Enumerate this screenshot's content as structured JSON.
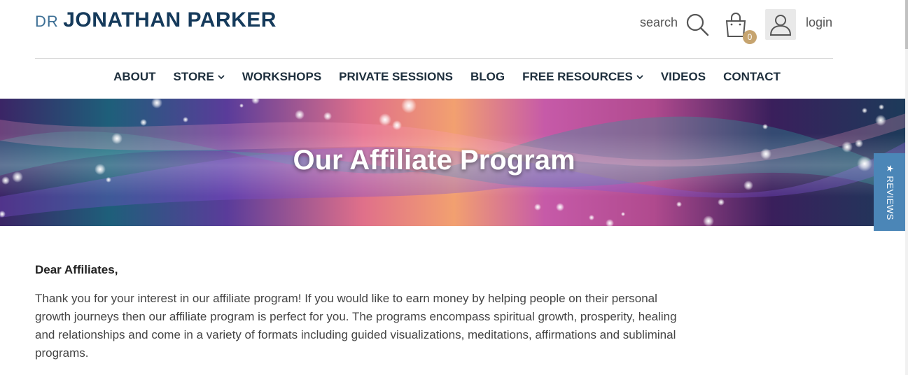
{
  "header": {
    "logo_prefix": "DR",
    "logo_name": "JONATHAN PARKER",
    "search_label": "search",
    "cart_count": "0",
    "login_label": "login",
    "nav": [
      {
        "label": "ABOUT",
        "dropdown": false
      },
      {
        "label": "STORE",
        "dropdown": true
      },
      {
        "label": "WORKSHOPS",
        "dropdown": false
      },
      {
        "label": "PRIVATE SESSIONS",
        "dropdown": false
      },
      {
        "label": "BLOG",
        "dropdown": false
      },
      {
        "label": "FREE RESOURCES",
        "dropdown": true
      },
      {
        "label": "VIDEOS",
        "dropdown": false
      },
      {
        "label": "CONTACT",
        "dropdown": false
      }
    ]
  },
  "banner": {
    "title": "Our Affiliate Program"
  },
  "reviews_tab": {
    "label": "★ REVIEWS"
  },
  "content": {
    "greeting": "Dear Affiliates,",
    "paragraph": "Thank you for your interest in our affiliate program! If you would like to earn money by helping people on their personal growth journeys then our affiliate program is perfect for you. The programs encompass spiritual growth, prosperity, healing and relationships and come in a variety of formats including guided visualizations, meditations, affirmations and subliminal programs."
  },
  "colors": {
    "logo_dark": "#153a5b",
    "logo_light": "#3d6f95",
    "cart_badge": "#c6a46f",
    "reviews_tab": "#4b86b7",
    "nav_text": "#1e2f3d"
  },
  "icons": {
    "search": "search-icon",
    "cart": "shopping-bag-icon",
    "user": "user-icon",
    "chevron": "chevron-down-icon"
  }
}
